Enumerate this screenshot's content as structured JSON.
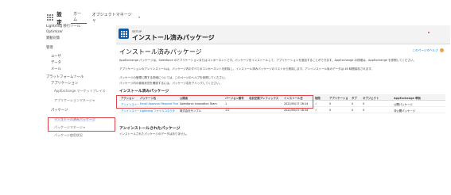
{
  "topbar": {
    "app_name": "設定",
    "tabs": [
      {
        "label": "ホーム"
      },
      {
        "label": "オブジェクトマネージャ"
      }
    ]
  },
  "sidebar": {
    "items": [
      {
        "label": "Lightning 移行ツール",
        "level": 0
      },
      {
        "label": "Optimizer",
        "level": 0
      },
      {
        "label": "異動対策",
        "level": 0
      },
      {
        "label": "管理",
        "level": 0
      },
      {
        "label": "ユーザ",
        "level": 1
      },
      {
        "label": "データ",
        "level": 1
      },
      {
        "label": "メール",
        "level": 1
      },
      {
        "label": "プラットフォームツール",
        "level": 0
      },
      {
        "label": "アプリケーション",
        "level": 1
      },
      {
        "label": "AppExchange マーケットプレイス",
        "level": 2
      },
      {
        "label": "アプリケーションマネージャ",
        "level": 2
      },
      {
        "label": "パッケージ",
        "level": 1
      },
      {
        "label": "インストール済みパッケージ",
        "level": 2,
        "active": true
      },
      {
        "label": "パッケージマネージャ",
        "level": 2
      },
      {
        "label": "パッケージ使用状況",
        "level": 2
      }
    ]
  },
  "header": {
    "eyebrow": "SETUP",
    "title": "インストール済みパッケージ"
  },
  "content": {
    "heading": "インストール済みパッケージ",
    "help_link": "このページのヘルプ",
    "descriptions": [
      "AppExchange パッケージは、Salesforce のアプリケーションまたはコンポーネントです。パッケージをインストールして、アプリケーションを追加することができます。AppExchange の詳細は、AppExchange を参照してください。",
      "アプリケーションのアンインストールは、パッケージ内のすべてのコンポーネントを削除し、インストール済みパッケージのリストから削除します。アンインストール後のデータは 48 時間保存されます。",
      "パッケージの管理に関する詳細については、このページのヘルプを参照してください。",
      "パッケージ内の使用状況を確認するには、パッケージ名をクリックしてください。"
    ],
    "installed_section_title": "インストール済みパッケージ",
    "uninstalled_section_title": "アンインストールされたパッケージ",
    "uninstalled_desc": "インストールされたパッケージのデータはありません。"
  },
  "table": {
    "headers": [
      "アクション",
      "パッケージ名",
      "公開者",
      "バージョン番号",
      "名前空間プレフィックス",
      "インストール日",
      "制限",
      "アプリケーション",
      "タブ",
      "オブジェクト",
      "AppExchange 準拠"
    ],
    "rows": [
      [
        "アンインストール",
        "Email Approval Request Flow",
        "Salesforce Innovation Team",
        "1",
        "",
        "2022/05/17 18:24",
        "✓",
        "0",
        "0",
        "0",
        "公開パッケージ"
      ],
      [
        "アンインストール",
        "Lightning ファイルコネクタ",
        "株式会社サンプル",
        "1.0",
        "",
        "2022/05/27 18:34",
        "✓",
        "0",
        "0",
        "0",
        "非公開パッケージ"
      ]
    ]
  },
  "colors": {
    "highlight": "#e0474c",
    "brand": "#0b5cab",
    "link": "#0176d3"
  }
}
